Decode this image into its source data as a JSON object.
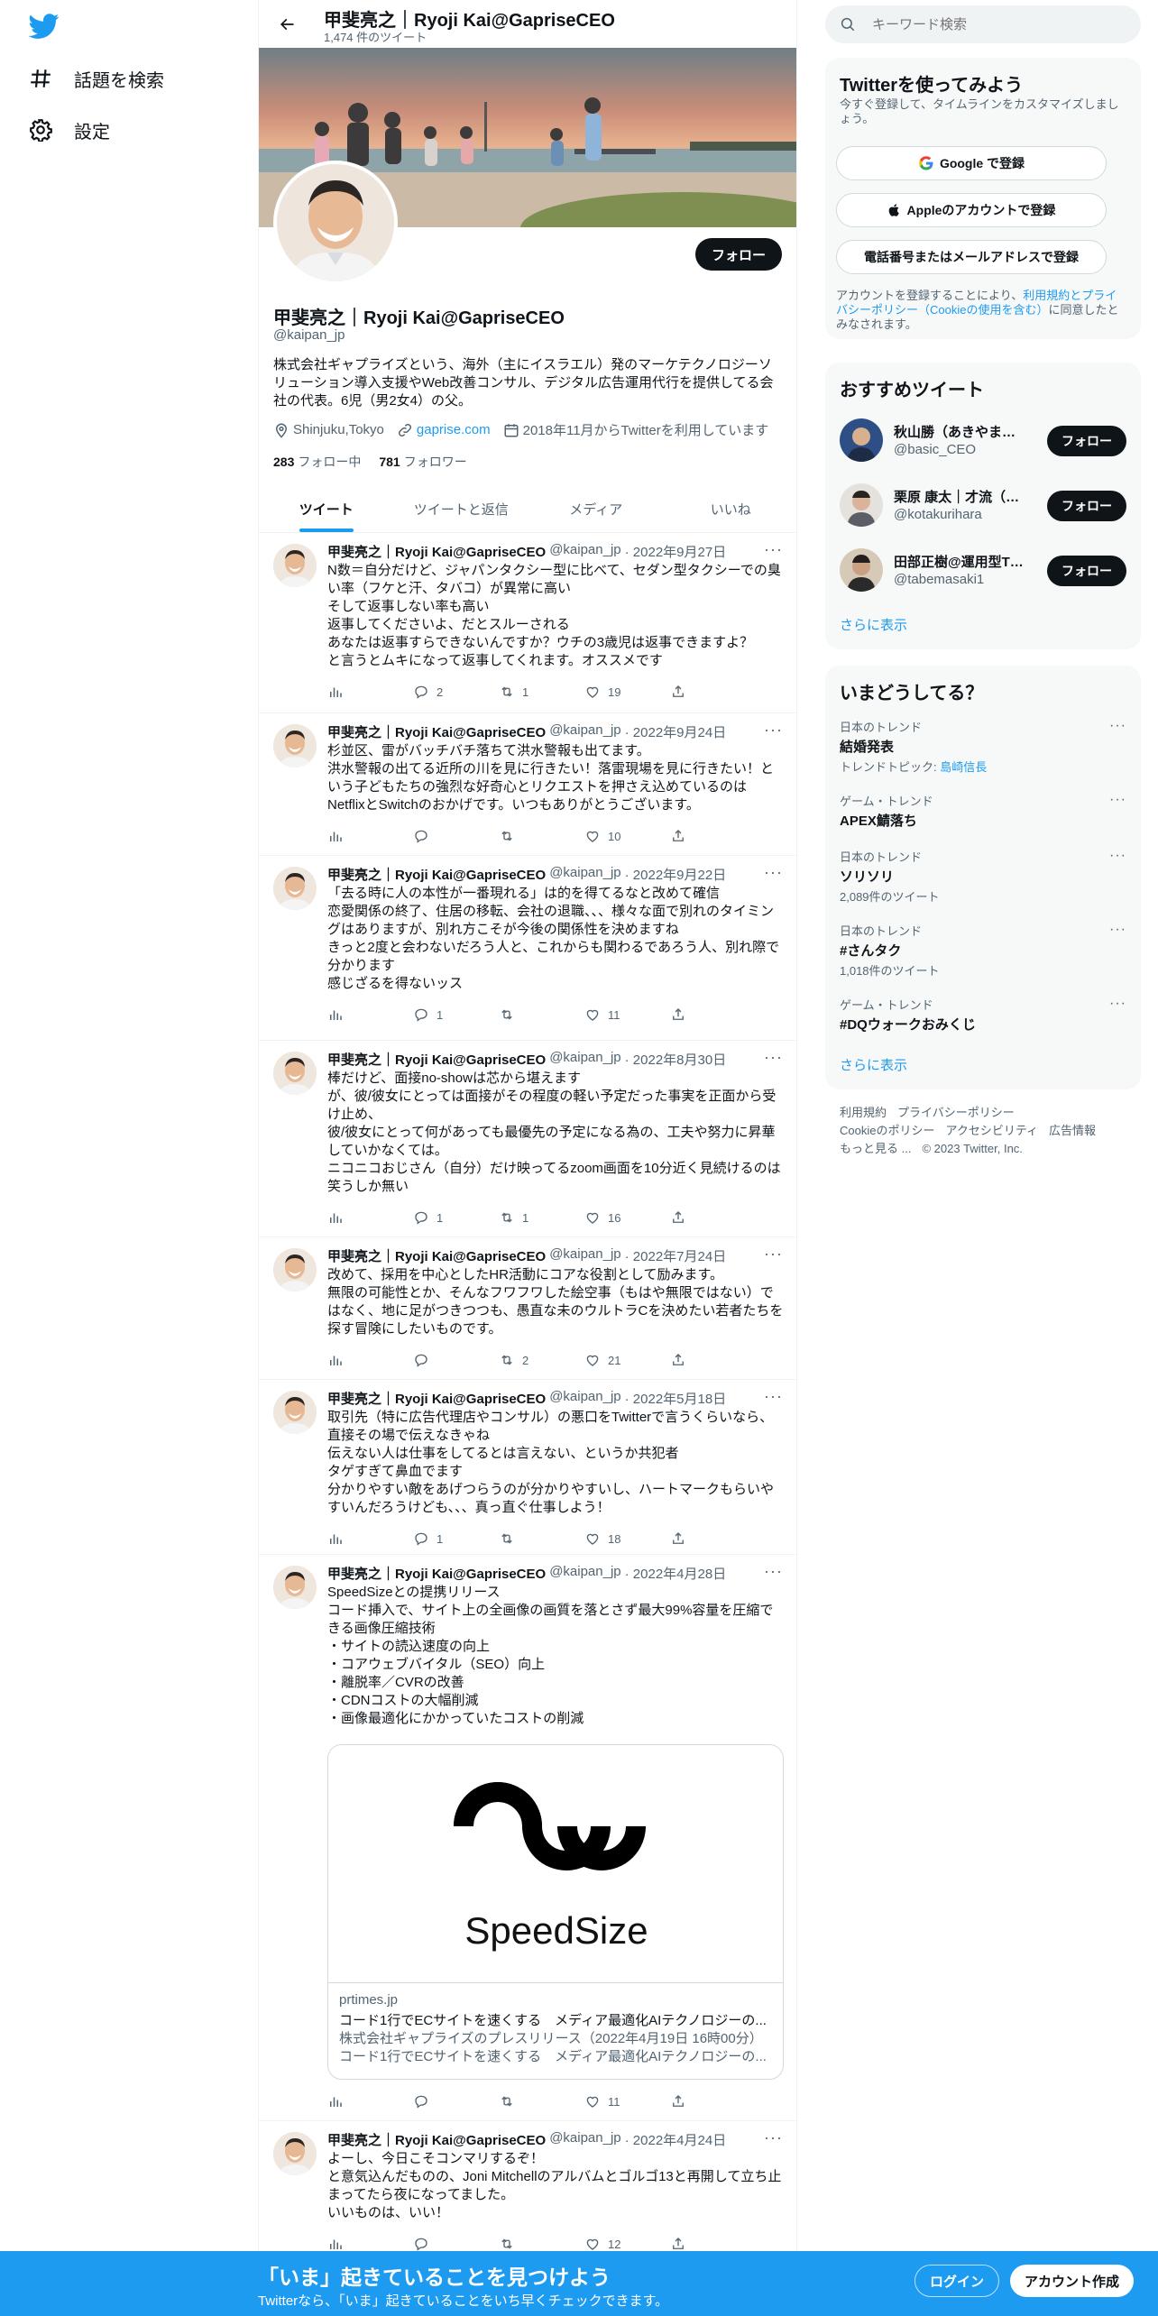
{
  "nav": {
    "logo": "twitter-bird",
    "explore": "話題を検索",
    "settings": "設定"
  },
  "header": {
    "name": "甲斐亮之｜Ryoji Kai@GapriseCEO",
    "tweet_count": "1,474 件のツイート"
  },
  "profile": {
    "follow": "フォロー",
    "name": "甲斐亮之｜Ryoji Kai@GapriseCEO",
    "handle": "@kaipan_jp",
    "bio": "株式会社ギャプライズという、海外（主にイスラエル）発のマーケテクノロジーソリューション導入支援やWeb改善コンサル、デジタル広告運用代行を提供してる会社の代表。6児（男2女4）の父。",
    "location": "Shinjuku,Tokyo",
    "website": "gaprise.com",
    "joined": "2018年11月からTwitterを利用しています",
    "following_count": "283",
    "following_label": "フォロー中",
    "followers_count": "781",
    "followers_label": "フォロワー"
  },
  "tabs": [
    "ツイート",
    "ツイートと返信",
    "メディア",
    "いいね"
  ],
  "tweets": [
    {
      "name": "甲斐亮之｜Ryoji Kai@GapriseCEO",
      "handle": "@kaipan_jp",
      "date": "· 2022年9月27日",
      "text": "N数＝自分だけど、ジャパンタクシー型に比べて、セダン型タクシーでの臭い率（フケと汗、タバコ）が異常に高い\nそして返事しない率も高い\n返事してくださいよ、だとスルーされる\nあなたは返事すらできないんですか？ウチの3歳児は返事できますよ？\nと言うとムキになって返事してくれます。オススメです",
      "replies": "2",
      "retweets": "1",
      "likes": "19"
    },
    {
      "name": "甲斐亮之｜Ryoji Kai@GapriseCEO",
      "handle": "@kaipan_jp",
      "date": "· 2022年9月24日",
      "text": "杉並区、雷がバッチバチ落ちて洪水警報も出てます。\n洪水警報の出てる近所の川を見に行きたい！落雷現場を見に行きたい！という子どもたちの強烈な好奇心とリクエストを押さえ込めているのはNetflixとSwitchのおかげです。いつもありがとうございます。",
      "replies": "",
      "retweets": "",
      "likes": "10"
    },
    {
      "name": "甲斐亮之｜Ryoji Kai@GapriseCEO",
      "handle": "@kaipan_jp",
      "date": "· 2022年9月22日",
      "text": "「去る時に人の本性が一番現れる」は的を得てるなと改めて確信\n恋愛関係の終了、住居の移転、会社の退職、、、様々な面で別れのタイミングはありますが、別れ方こそが今後の関係性を決めますね\nきっと2度と会わないだろう人と、これからも関わるであろう人、別れ際で分かります\n感じざるを得ないッス",
      "replies": "1",
      "retweets": "",
      "likes": "11"
    },
    {
      "name": "甲斐亮之｜Ryoji Kai@GapriseCEO",
      "handle": "@kaipan_jp",
      "date": "· 2022年8月30日",
      "text": "棒だけど、面接no-showは芯から堪えます\nが、彼/彼女にとっては面接がその程度の軽い予定だった事実を正面から受け止め、\n彼/彼女にとって何があっても最優先の予定になる為の、工夫や努力に昇華していかなくては。\nニコニコおじさん（自分）だけ映ってるzoom画面を10分近く見続けるのは笑うしか無い",
      "replies": "1",
      "retweets": "1",
      "likes": "16"
    },
    {
      "name": "甲斐亮之｜Ryoji Kai@GapriseCEO",
      "handle": "@kaipan_jp",
      "date": "· 2022年7月24日",
      "text": "改めて、採用を中心としたHR活動にコアな役割として励みます。\n無限の可能性とか、そんなフワフワした絵空事（もはや無限ではない）ではなく、地に足がつきつつも、愚直な未のウルトラCを決めたい若者たちを探す冒険にしたいものです。",
      "replies": "",
      "retweets": "2",
      "likes": "21"
    },
    {
      "name": "甲斐亮之｜Ryoji Kai@GapriseCEO",
      "handle": "@kaipan_jp",
      "date": "· 2022年5月18日",
      "text": "取引先（特に広告代理店やコンサル）の悪口をTwitterで言うくらいなら、直接その場で伝えなきゃね\n伝えない人は仕事をしてるとは言えない、というか共犯者\nタゲすぎて鼻血でます\n分かりやすい敵をあげつらうのが分かりやすいし、ハートマークもらいやすいんだろうけども、、、真っ直ぐ仕事しよう！",
      "replies": "1",
      "retweets": "",
      "likes": "18"
    },
    {
      "name": "甲斐亮之｜Ryoji Kai@GapriseCEO",
      "handle": "@kaipan_jp",
      "date": "· 2022年4月28日",
      "text": "SpeedSizeとの提携リリース\nコード挿入で、サイト上の全画像の画質を落とさず最大99%容量を圧縮できる画像圧縮技術\n・サイトの読込速度の向上\n・コアウェブバイタル（SEO）向上\n・離脱率／CVRの改善\n・CDNコストの大幅削減\n・画像最適化にかかっていたコストの削減",
      "replies": "",
      "retweets": "",
      "likes": "11",
      "card": {
        "logo_text": "SpeedSize",
        "domain": "prtimes.jp",
        "title": "コード1行でECサイトを速くする　メディア最適化AIテクノロジーの...",
        "desc1": "株式会社ギャプライズのプレスリリース（2022年4月19日 16時00分）",
        "desc2": "コード1行でECサイトを速くする　メディア最適化AIテクノロジーの..."
      }
    },
    {
      "name": "甲斐亮之｜Ryoji Kai@GapriseCEO",
      "handle": "@kaipan_jp",
      "date": "· 2022年4月24日",
      "text": "よーし、今日こそコンマリするぞ！\nと意気込んだものの、Joni Mitchellのアルバムとゴルゴ13と再開して立ち止まってたら夜になってました。\nいいものは、いい！",
      "replies": "",
      "retweets": "",
      "likes": "12"
    }
  ],
  "search": {
    "placeholder": "キーワード検索"
  },
  "join": {
    "title": "Twitterを使ってみよう",
    "subtitle": "今すぐ登録して、タイムラインをカスタマイズしましょう。",
    "google": "Google で登録",
    "apple": "Appleのアカウントで登録",
    "phone": "電話番号またはメールアドレスで登録",
    "terms_pre": "アカウントを登録することにより、",
    "terms_link": "利用規約とプライバシーポリシー（Cookieの使用を含む）",
    "terms_post": "に同意したとみなされます。"
  },
  "recommend": {
    "title": "おすすめツイート",
    "users": [
      {
        "name": "秋山勝（あきやままさる）",
        "handle": "@basic_CEO",
        "follow": "フォロー"
      },
      {
        "name": "栗原 康太｜才流（サイル）",
        "handle": "@kotakurihara",
        "follow": "フォロー"
      },
      {
        "name": "田部正樹@運用型TVCM",
        "handle": "@tabemasaki1",
        "follow": "フォロー"
      }
    ],
    "more": "さらに表示"
  },
  "trends": {
    "title": "いまどうしてる？",
    "items": [
      {
        "context": "日本のトレンド",
        "topic": "結婚発表",
        "sub_label": "トレンドトピック: ",
        "sub_link": "島崎信長"
      },
      {
        "context": "ゲーム・トレンド",
        "topic": "APEX鯖落ち",
        "sub": ""
      },
      {
        "context": "日本のトレンド",
        "topic": "ソリソリ",
        "sub": "2,089件のツイート"
      },
      {
        "context": "日本のトレンド",
        "topic": "#さんタク",
        "sub": "1,018件のツイート"
      },
      {
        "context": "ゲーム・トレンド",
        "topic": "#DQウォークおみくじ",
        "sub": ""
      }
    ],
    "more": "さらに表示"
  },
  "footer": {
    "links": [
      "利用規約",
      "プライバシーポリシー",
      "Cookieのポリシー",
      "アクセシビリティ",
      "広告情報",
      "もっと見る ..."
    ],
    "copyright": "© 2023 Twitter, Inc."
  },
  "bottom": {
    "title": "「いま」起きていることを見つけよう",
    "subtitle": "Twitterなら、「いま」起きていることをいち早くチェックできます。",
    "login": "ログイン",
    "signup": "アカウント作成"
  },
  "colors": {
    "accent": "#1d9bf0",
    "text": "#0f1419",
    "muted": "#536471",
    "border": "#eff3f4"
  }
}
